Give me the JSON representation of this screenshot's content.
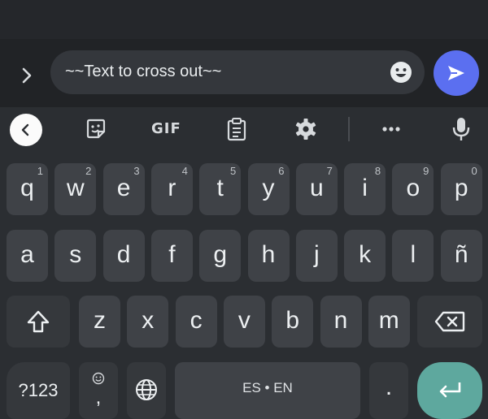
{
  "compose": {
    "input_text": "~~Text to cross out~~"
  },
  "toolbar": {
    "gif_label": "GIF",
    "icons": [
      "back-icon",
      "sticker-icon",
      "gif-icon",
      "clipboard-icon",
      "gear-icon",
      "more-icon",
      "mic-icon"
    ]
  },
  "keyboard": {
    "row1": [
      {
        "label": "q",
        "hint": "1"
      },
      {
        "label": "w",
        "hint": "2"
      },
      {
        "label": "e",
        "hint": "3"
      },
      {
        "label": "r",
        "hint": "4"
      },
      {
        "label": "t",
        "hint": "5"
      },
      {
        "label": "y",
        "hint": "6"
      },
      {
        "label": "u",
        "hint": "7"
      },
      {
        "label": "i",
        "hint": "8"
      },
      {
        "label": "o",
        "hint": "9"
      },
      {
        "label": "p",
        "hint": "0"
      }
    ],
    "row2": [
      "a",
      "s",
      "d",
      "f",
      "g",
      "h",
      "j",
      "k",
      "l",
      "ñ"
    ],
    "row3": [
      "z",
      "x",
      "c",
      "v",
      "b",
      "n",
      "m"
    ],
    "symbols_label": "?123",
    "comma_label": ",",
    "space_label": "ES • EN",
    "period_label": "."
  },
  "colors": {
    "send": "#5b6ff0",
    "enter": "#5ea89e",
    "key": "#3f4247"
  }
}
